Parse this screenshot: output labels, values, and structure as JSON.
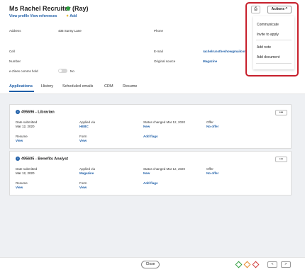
{
  "header": {
    "name": "Ms Rachel Recruiter (Ray)",
    "links": "View profile View references",
    "add_label": "Add"
  },
  "details": {
    "address_label": "Address",
    "address_value": "435 Sunny Lane",
    "phone_label": "Phone",
    "cell_label": "Cell",
    "email_label": "E-mail",
    "email_value": "rachelrunstheshowgmailcom",
    "number_label": "Number",
    "original_source_label": "Original source",
    "original_source_value": "Magazine",
    "ezines_label": "e-Zines comms hold",
    "ezines_value": "No"
  },
  "tabs": [
    "Applications",
    "History",
    "Scheduled emails",
    "CRM",
    "Resume"
  ],
  "actions": {
    "button_label": "Actions",
    "menu": [
      "Communicate",
      "Invite to apply",
      "Add note",
      "Add document"
    ]
  },
  "applications": [
    {
      "title": "495696 - Librarian",
      "date_submitted_label": "Date submitted",
      "date_submitted": "Mar 12, 2020",
      "applied_via_label": "Applied via",
      "applied_via": "HEBC",
      "status_label": "Status changed Mar 12, 2020",
      "status": "New",
      "offer_label": "Offer",
      "offer": "No offer",
      "resume_label": "Resume",
      "resume": "View",
      "form_label": "Form",
      "form": "View",
      "flags": "Add flags"
    },
    {
      "title": "495605 - Benefits Analyst",
      "date_submitted_label": "Date submitted",
      "date_submitted": "Mar 12, 2020",
      "applied_via_label": "Applied via",
      "applied_via": "Magazine",
      "status_label": "Status changed Mar 12, 2020",
      "status": "New",
      "offer_label": "Offer",
      "offer": "No offer",
      "resume_label": "Resume",
      "resume": "View",
      "form_label": "Form",
      "form": "View",
      "flags": "Add flags"
    }
  ],
  "footer": {
    "close_label": "Close",
    "dots_label": "•••",
    "prev_label": "<",
    "next_label": ">"
  },
  "colors": {
    "link": "#1f5fa8",
    "status_active": "#2e9e3e",
    "highlight": "#c7202c",
    "diamond_green": "#2e9e3e",
    "diamond_orange": "#e8892a",
    "diamond_red": "#d13b3b"
  },
  "icons": [
    "printer-icon",
    "chevron-up-icon",
    "info-icon",
    "star-icon",
    "chevron-left-icon",
    "chevron-right-icon"
  ]
}
